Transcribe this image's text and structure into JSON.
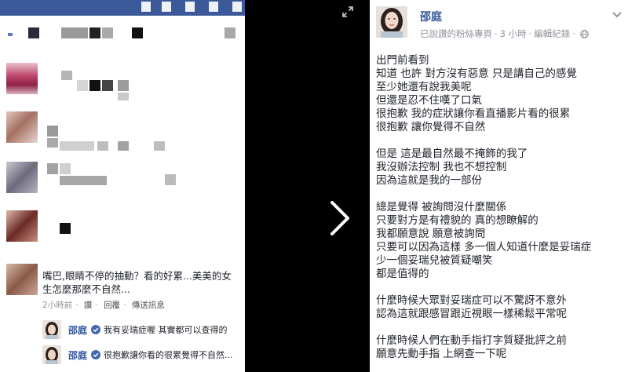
{
  "overlay_comment": {
    "line1": "嘴巴,眼睛不停的抽動？看的好累...美美的女",
    "line2": "生怎麼那麼不自然...",
    "time": "2小時前",
    "like": "讚",
    "reply": "回覆",
    "message": "傳送訊息",
    "dot": "·"
  },
  "replies": [
    {
      "name": "邵庭",
      "text": "我有妥瑞症喔 其實都可以查得的"
    },
    {
      "name": "邵庭",
      "text": "很抱歉讓你看的很累覺得不自然..."
    }
  ],
  "post": {
    "author": "邵庭",
    "page_type": "已說讚的粉絲專頁",
    "time": "3 小時",
    "edit_history": "編輯紀錄",
    "dot": "·",
    "lines": [
      "出門前看到",
      "知道 也許 對方沒有惡意 只是講自己的感覺",
      "至少她還有說我美呢",
      "但還是忍不住嘆了口氣",
      "很抱歉 我的症狀讓你看直播影片看的很累",
      "很抱歉 讓你覺得不自然",
      "",
      "但是 這是最自然最不掩飾的我了",
      "我沒辦法控制 我也不想控制",
      "因為這就是我的一部份",
      "",
      "總是覺得 被詢問沒什麼關係",
      "只要對方是有禮貌的 真的想瞭解的",
      "我都願意說 願意被詢問",
      "只要可以因為這樣 多一個人知道什麼是妥瑞症",
      "少一個妥瑞兒被質疑嘲笑",
      "都是值得的",
      "",
      "什麼時候大眾對妥瑞症可以不驚訝不意外",
      "認為這就跟感冒跟近視眼一樣稀鬆平常呢",
      "",
      "什麼時候人們在動手指打字質疑批評之前",
      "願意先動手指 上網查一下呢"
    ]
  },
  "icons": {
    "expand": "expand-icon",
    "next": "chevron-right-icon",
    "verified": "verified-check-icon",
    "globe": "globe-icon",
    "menu": "chevron-down-icon"
  },
  "colors": {
    "facebook_blue": "#3b5998",
    "link_blue": "#365899",
    "verified_blue": "#4267b2",
    "meta_gray": "#90949c"
  }
}
